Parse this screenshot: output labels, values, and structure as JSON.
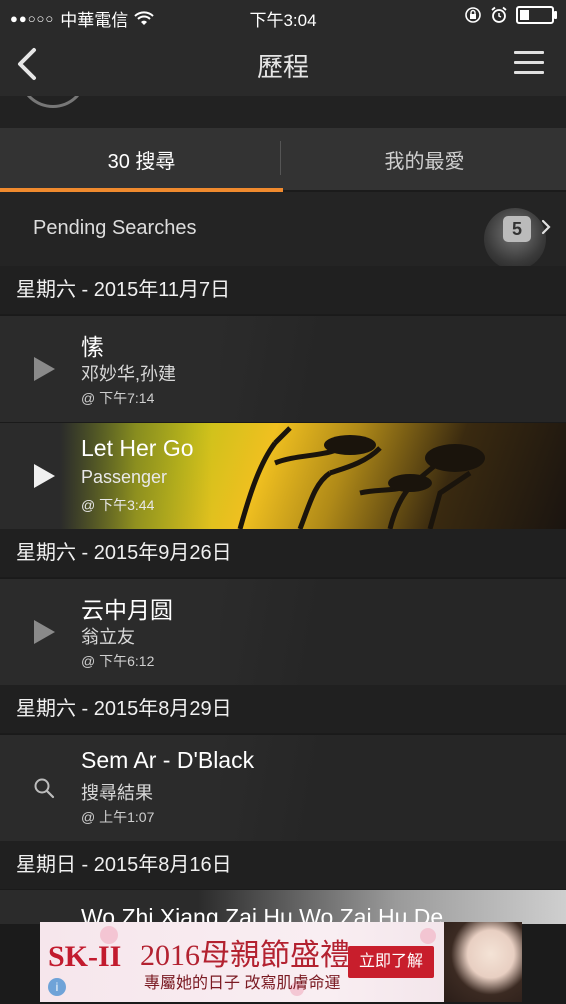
{
  "status_bar": {
    "signal": "●●○○○",
    "carrier": "中華電信",
    "time": "下午3:04",
    "battery_level": 0.3
  },
  "nav": {
    "title": "歷程"
  },
  "tabs": [
    {
      "label": "30 搜尋",
      "active": true
    },
    {
      "label": "我的最愛",
      "active": false
    }
  ],
  "pending": {
    "label": "Pending Searches",
    "count": "5"
  },
  "sections": [
    {
      "date": "星期六 - 2015年11月7日",
      "items": [
        {
          "title": "愫",
          "subtitle": "邓妙华,孙建",
          "time": "@ 下午7:14",
          "type": "play"
        },
        {
          "title": "Let Her Go",
          "subtitle": "Passenger",
          "time": "@ 下午3:44",
          "type": "play"
        }
      ]
    },
    {
      "date": "星期六 - 2015年9月26日",
      "items": [
        {
          "title": "云中月圆",
          "subtitle": "翁立友",
          "time": "@ 下午6:12",
          "type": "play"
        }
      ]
    },
    {
      "date": "星期六 - 2015年8月29日",
      "items": [
        {
          "title": "Sem Ar - D'Black",
          "subtitle": "搜尋結果",
          "time": "@ 上午1:07",
          "type": "search"
        }
      ]
    },
    {
      "date": "星期日 - 2015年8月16日",
      "items": [
        {
          "title": "Wo Zhi Xiang Zai Hu Wo Zai Hu De",
          "type": "play"
        }
      ]
    }
  ],
  "ad": {
    "brand": "SK-II",
    "headline": "2016母親節盛禮",
    "subline": "專屬她的日子 改寫肌膚命運",
    "cta": "立即了解",
    "info": "i"
  },
  "colors": {
    "accent": "#f08a2e",
    "background": "#1b1b1b",
    "row": "#2b2b2b",
    "ad_red": "#c81e2c"
  }
}
